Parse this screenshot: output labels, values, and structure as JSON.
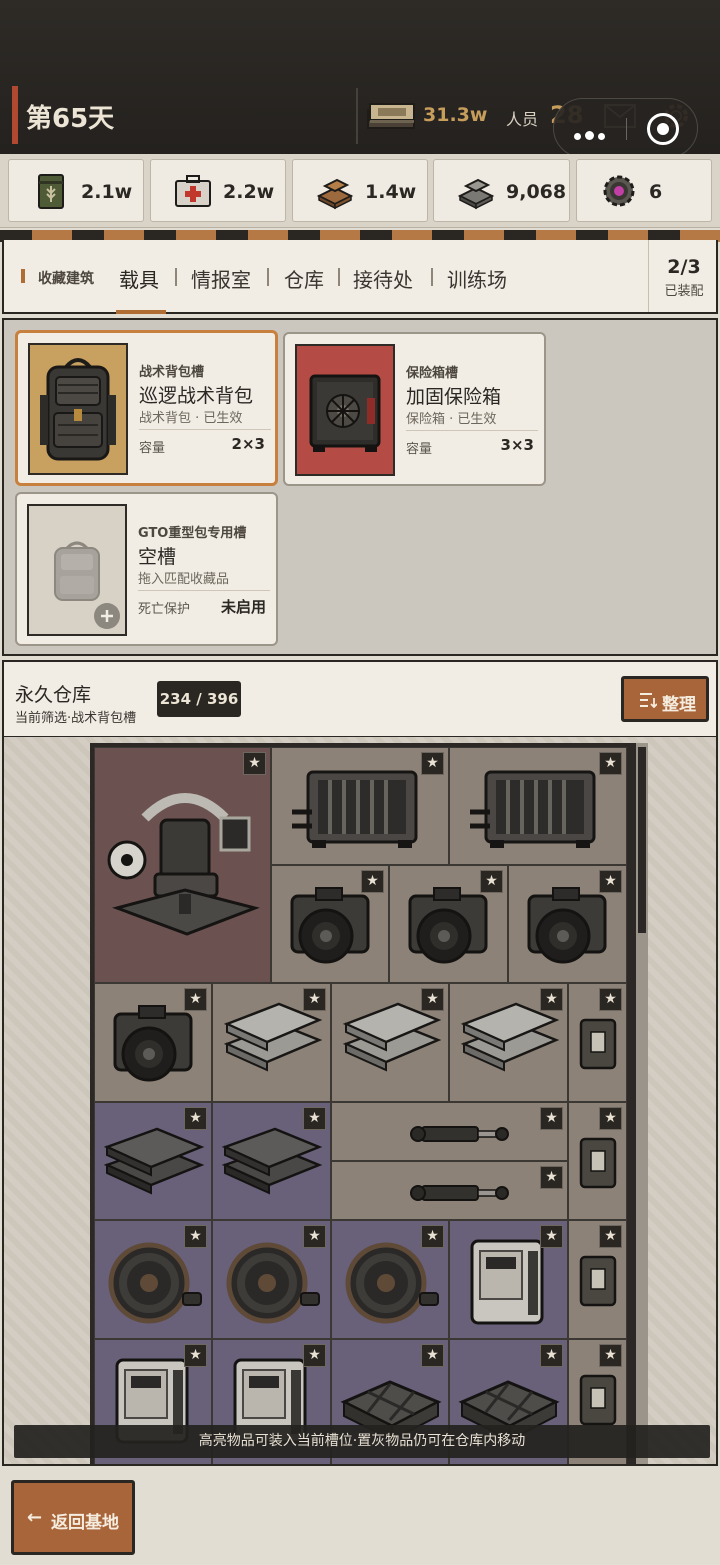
{
  "header": {
    "day": "第65天",
    "money": "31.3w",
    "crew_label": "人员",
    "crew_count": "28",
    "icons": [
      "money-stack-icon",
      "mail-icon",
      "gear-icon",
      "more-dots-icon",
      "record-target-icon"
    ]
  },
  "resources": [
    {
      "icon": "grain-can-icon",
      "value": "2.1w"
    },
    {
      "icon": "medkit-icon",
      "value": "2.2w"
    },
    {
      "icon": "wood-planks-icon",
      "value": "1.4w"
    },
    {
      "icon": "metal-ingots-icon",
      "value": "9,068"
    },
    {
      "icon": "gear-core-icon",
      "value": "6"
    }
  ],
  "tabs": {
    "section_label": "收藏建筑",
    "items": [
      "载具",
      "情报室",
      "仓库",
      "接待处",
      "训练场"
    ],
    "active": "载具",
    "equipped_count": "2/3",
    "equipped_label": "已装配"
  },
  "slots": [
    {
      "category": "战术背包槽",
      "name": "巡逻战术背包",
      "sub": "战术背包 · 已生效",
      "key": "容量",
      "value": "2×3",
      "icon": "tactical-backpack-icon",
      "selected": true
    },
    {
      "category": "保险箱槽",
      "name": "加固保险箱",
      "sub": "保险箱 · 已生效",
      "key": "容量",
      "value": "3×3",
      "icon": "safe-box-icon",
      "selected": false
    },
    {
      "category": "GTO重型包专用槽",
      "name": "空槽",
      "sub": "拖入匹配收藏品",
      "key": "死亡保护",
      "value": "未启用",
      "icon": "empty-backpack-icon",
      "selected": false
    }
  ],
  "warehouse": {
    "title": "永久仓库",
    "filter": "当前筛选·战术背包槽",
    "count": "234 / 396",
    "sort_label": "整理",
    "toast": "高亮物品可装入当前槽位·置灰物品仍可在仓库内移动",
    "item_names": [
      "command-chair-icon",
      "generator-crate-icon",
      "camera-icon",
      "armor-plate-icon",
      "steel-plate-icon",
      "hydraulic-piston-icon",
      "pouch-icon",
      "cable-reel-icon",
      "power-unit-icon",
      "storage-tray-icon"
    ]
  },
  "footer": {
    "back_label": "返回基地"
  },
  "colors": {
    "accent": "#b06d33",
    "button": "#a9653a",
    "dark": "#2a2723",
    "money": "#c79d5c",
    "day_accent": "#b0492f"
  }
}
